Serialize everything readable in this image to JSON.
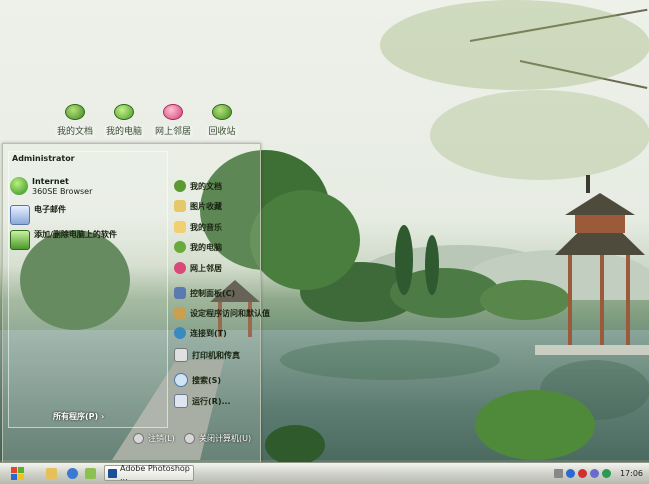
{
  "desktop_icons": [
    {
      "label": "我的文档",
      "icon": "my-documents-icon"
    },
    {
      "label": "我的电脑",
      "icon": "my-computer-icon"
    },
    {
      "label": "网上邻居",
      "icon": "network-places-icon"
    },
    {
      "label": "回收站",
      "icon": "recycle-bin-icon"
    }
  ],
  "start_menu": {
    "user": "Administrator",
    "pinned": [
      {
        "title": "Internet",
        "subtitle": "360SE Browser",
        "icon": "browser-icon"
      },
      {
        "title": "电子邮件",
        "subtitle": "",
        "icon": "email-icon"
      },
      {
        "title": "添加/删除电脑上的软件",
        "subtitle": "",
        "icon": "add-remove-software-icon"
      }
    ],
    "all_programs": "所有程序(P)",
    "right_items": [
      {
        "label": "我的文档",
        "icon": "my-documents-icon"
      },
      {
        "label": "图片收藏",
        "icon": "my-pictures-icon"
      },
      {
        "label": "我的音乐",
        "icon": "my-music-icon"
      },
      {
        "label": "我的电脑",
        "icon": "my-computer-icon"
      },
      {
        "label": "网上邻居",
        "icon": "network-places-icon"
      },
      {
        "label": "控制面板(C)",
        "icon": "control-panel-icon"
      },
      {
        "label": "设定程序访问和默认值",
        "icon": "program-defaults-icon"
      },
      {
        "label": "连接到(T)",
        "icon": "connect-to-icon"
      },
      {
        "label": "打印机和传真",
        "icon": "printers-icon"
      },
      {
        "label": "搜索(S)",
        "icon": "search-icon"
      },
      {
        "label": "运行(R)...",
        "icon": "run-icon"
      }
    ],
    "logoff": "注销(L)",
    "shutdown": "关闭计算机(U)"
  },
  "taskbar": {
    "task_label": "Adobe Photoshop ...",
    "clock": "17:06"
  }
}
